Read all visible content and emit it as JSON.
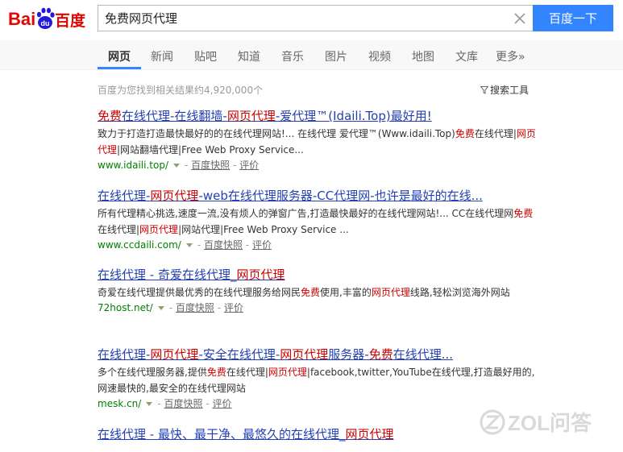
{
  "logo": {
    "bai": "Bai",
    "du_paw": "du",
    "cn": "百度"
  },
  "search": {
    "query": "免费网页代理",
    "button_label": "百度一下"
  },
  "nav": {
    "items": [
      {
        "label": "网页"
      },
      {
        "label": "新闻"
      },
      {
        "label": "贴吧"
      },
      {
        "label": "知道"
      },
      {
        "label": "音乐"
      },
      {
        "label": "图片"
      },
      {
        "label": "视频"
      },
      {
        "label": "地图"
      },
      {
        "label": "文库"
      },
      {
        "label": "更多»"
      }
    ]
  },
  "stats": {
    "text": "百度为您找到相关结果约4,920,000个"
  },
  "tools": {
    "label": "搜索工具"
  },
  "results": [
    {
      "title": [
        "免费",
        "在线代理-在线翻墙-",
        "网页代理",
        "-爱代理™(Idaili.Top)最好用!"
      ],
      "abstract": [
        "致力于打造打造最快最好的的在线代理网站!... 在线代理 爱代理™(Www.idaili.Top)",
        "免费",
        "在线代理|",
        "网页代理",
        "|网站翻墙代理|Free Web Proxy Service..."
      ],
      "url": "www.idaili.top/",
      "snapshot": "百度快照",
      "rate": "评价"
    },
    {
      "title": [
        "在线代理-",
        "网页代理",
        "-web在线代理服务器-CC代理网-也许是最好的在线..."
      ],
      "abstract": [
        "所有代理精心挑选,速度一流,没有烦人的弹窗广告,打造最快最好的在线代理网站!... CC在线代理网",
        "免费",
        "在线代理|",
        "网页代理",
        "|网站代理|Free Web Proxy Service ..."
      ],
      "url": "www.ccdaili.com/",
      "snapshot": "百度快照",
      "rate": "评价"
    },
    {
      "title": [
        "在线代理 - 奇爱在线代理_",
        "网页代理",
        ""
      ],
      "abstract": [
        "奇爱在线代理提供最优秀的在线代理服务给网民",
        "免费",
        "使用,丰富的",
        "网页代理",
        "线路,轻松浏览海外网站"
      ],
      "url": "72host.net/",
      "snapshot": "百度快照",
      "rate": "评价"
    },
    {
      "title": [
        "在线代理-",
        "网页代理",
        "-安全在线代理-",
        "网页代理",
        "服务器-",
        "免费",
        "在线代理..."
      ],
      "abstract": [
        "多个在线代理服务器,提供",
        "免费",
        "在线代理|",
        "网页代理",
        "|facebook,twitter,YouTube在线代理,打造最好用的,网速最快的,最安全的在线代理网站"
      ],
      "url": "mesk.cn/",
      "snapshot": "百度快照",
      "rate": "评价"
    },
    {
      "title": [
        "在线代理 - 最快、最干净、最悠久的在线代理_",
        "网页代理",
        ""
      ]
    }
  ],
  "watermark": {
    "text": "ZOL问答"
  },
  "colors": {
    "link": "#2440b3",
    "highlight": "#cc0000",
    "url": "#008000",
    "button": "#3385ff"
  }
}
